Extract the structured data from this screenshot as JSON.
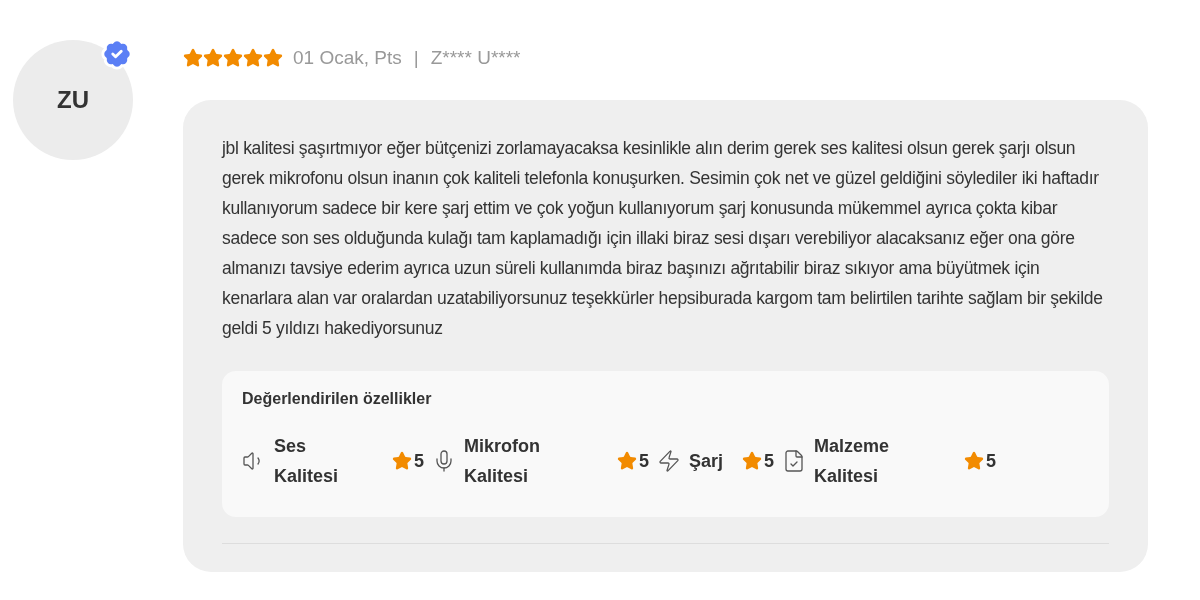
{
  "reviewer": {
    "initials": "ZU",
    "verified": true
  },
  "review": {
    "stars": 5,
    "date": "01 Ocak, Pts",
    "separator": "|",
    "name": "Z**** U****",
    "text": "jbl kalitesi şaşırtmıyor  eğer bütçenizi zorlamayacaksa kesinlikle alın derim gerek ses kalitesi olsun gerek şarjı olsun gerek mikrofonu olsun inanın çok kaliteli telefonla konuşurken. Sesimin çok net ve güzel geldiğini söylediler iki haftadır kullanıyorum sadece bir kere şarj ettim ve çok yoğun kullanıyorum şarj konusunda mükemmel ayrıca çokta kibar sadece son ses olduğunda kulağı tam kaplamadığı için illaki biraz sesi  dışarı verebiliyor alacaksanız eğer ona göre almanızı tavsiye ederim ayrıca uzun süreli kullanımda biraz başınızı ağrıtabilir biraz sıkıyor ama büyütmek için kenarlara alan var oralardan uzatabiliyorsunuz teşekkürler hepsiburada kargom tam belirtilen tarihte sağlam bir şekilde geldi 5 yıldızı hakediyorsunuz"
  },
  "features": {
    "title": "Değerlendirilen özellikler",
    "items": [
      {
        "kind": "speaker",
        "label": "Ses Kalitesi",
        "score": "5"
      },
      {
        "kind": "mic",
        "label": "Mikrofon Kalitesi",
        "score": "5"
      },
      {
        "kind": "bolt",
        "label": "Şarj",
        "score": "5"
      },
      {
        "kind": "material",
        "label": "Malzeme Kalitesi",
        "score": "5"
      }
    ]
  }
}
